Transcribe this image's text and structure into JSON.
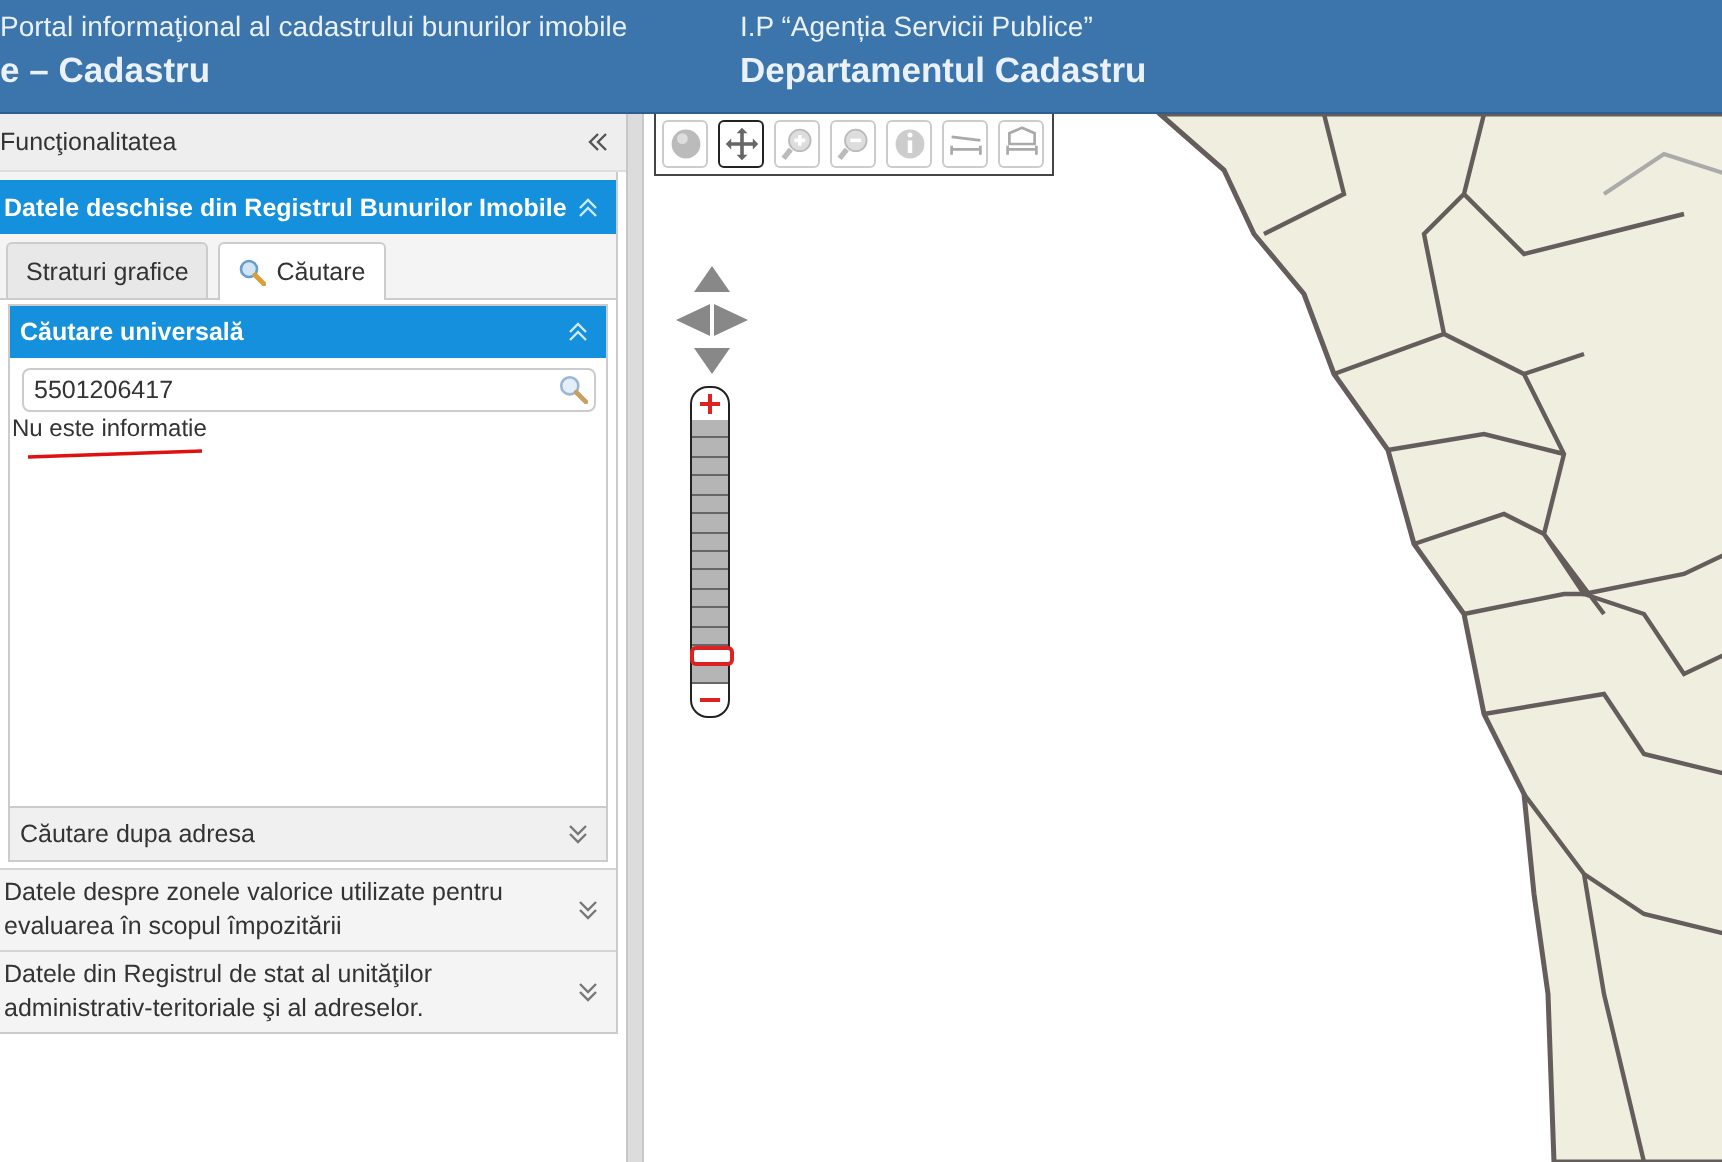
{
  "header": {
    "left_subtitle": "Portal informaţional al cadastrului bunurilor imobile",
    "left_title": "e – Cadastru",
    "right_subtitle": "I.P “Agenția Servicii Publice”",
    "right_title": "Departamentul Cadastru"
  },
  "sidebar": {
    "title": "Funcţionalitatea",
    "sections": [
      {
        "title": "Datele deschise din Registrul Bunurilor Imobile",
        "expanded": true,
        "tabs": [
          {
            "label": "Straturi grafice",
            "kind": "plain",
            "selected": false
          },
          {
            "label": "Căutare",
            "kind": "search",
            "selected": true
          }
        ],
        "subsections": [
          {
            "title": "Căutare universală",
            "expanded": true,
            "search_value": "5501206417",
            "message": "Nu este informatie"
          },
          {
            "title": "Căutare dupa adresa",
            "expanded": false
          }
        ]
      },
      {
        "title": "Datele despre zonele valorice utilizate pentru evaluarea în scopul împozitării",
        "expanded": false
      },
      {
        "title": "Datele din Registrul de stat al unităţilor administrativ-teritoriale şi al adreselor.",
        "expanded": false
      }
    ]
  },
  "map": {
    "kind": "picture",
    "tools": [
      {
        "kind": "globe",
        "selected": false
      },
      {
        "kind": "pan",
        "selected": true
      },
      {
        "kind": "zoom-in",
        "selected": false
      },
      {
        "kind": "zoom-out",
        "selected": false
      },
      {
        "kind": "info",
        "selected": false
      },
      {
        "kind": "measure-line",
        "selected": false
      },
      {
        "kind": "measure-area",
        "selected": false
      }
    ],
    "zoom": {
      "level": 0.07
    }
  }
}
